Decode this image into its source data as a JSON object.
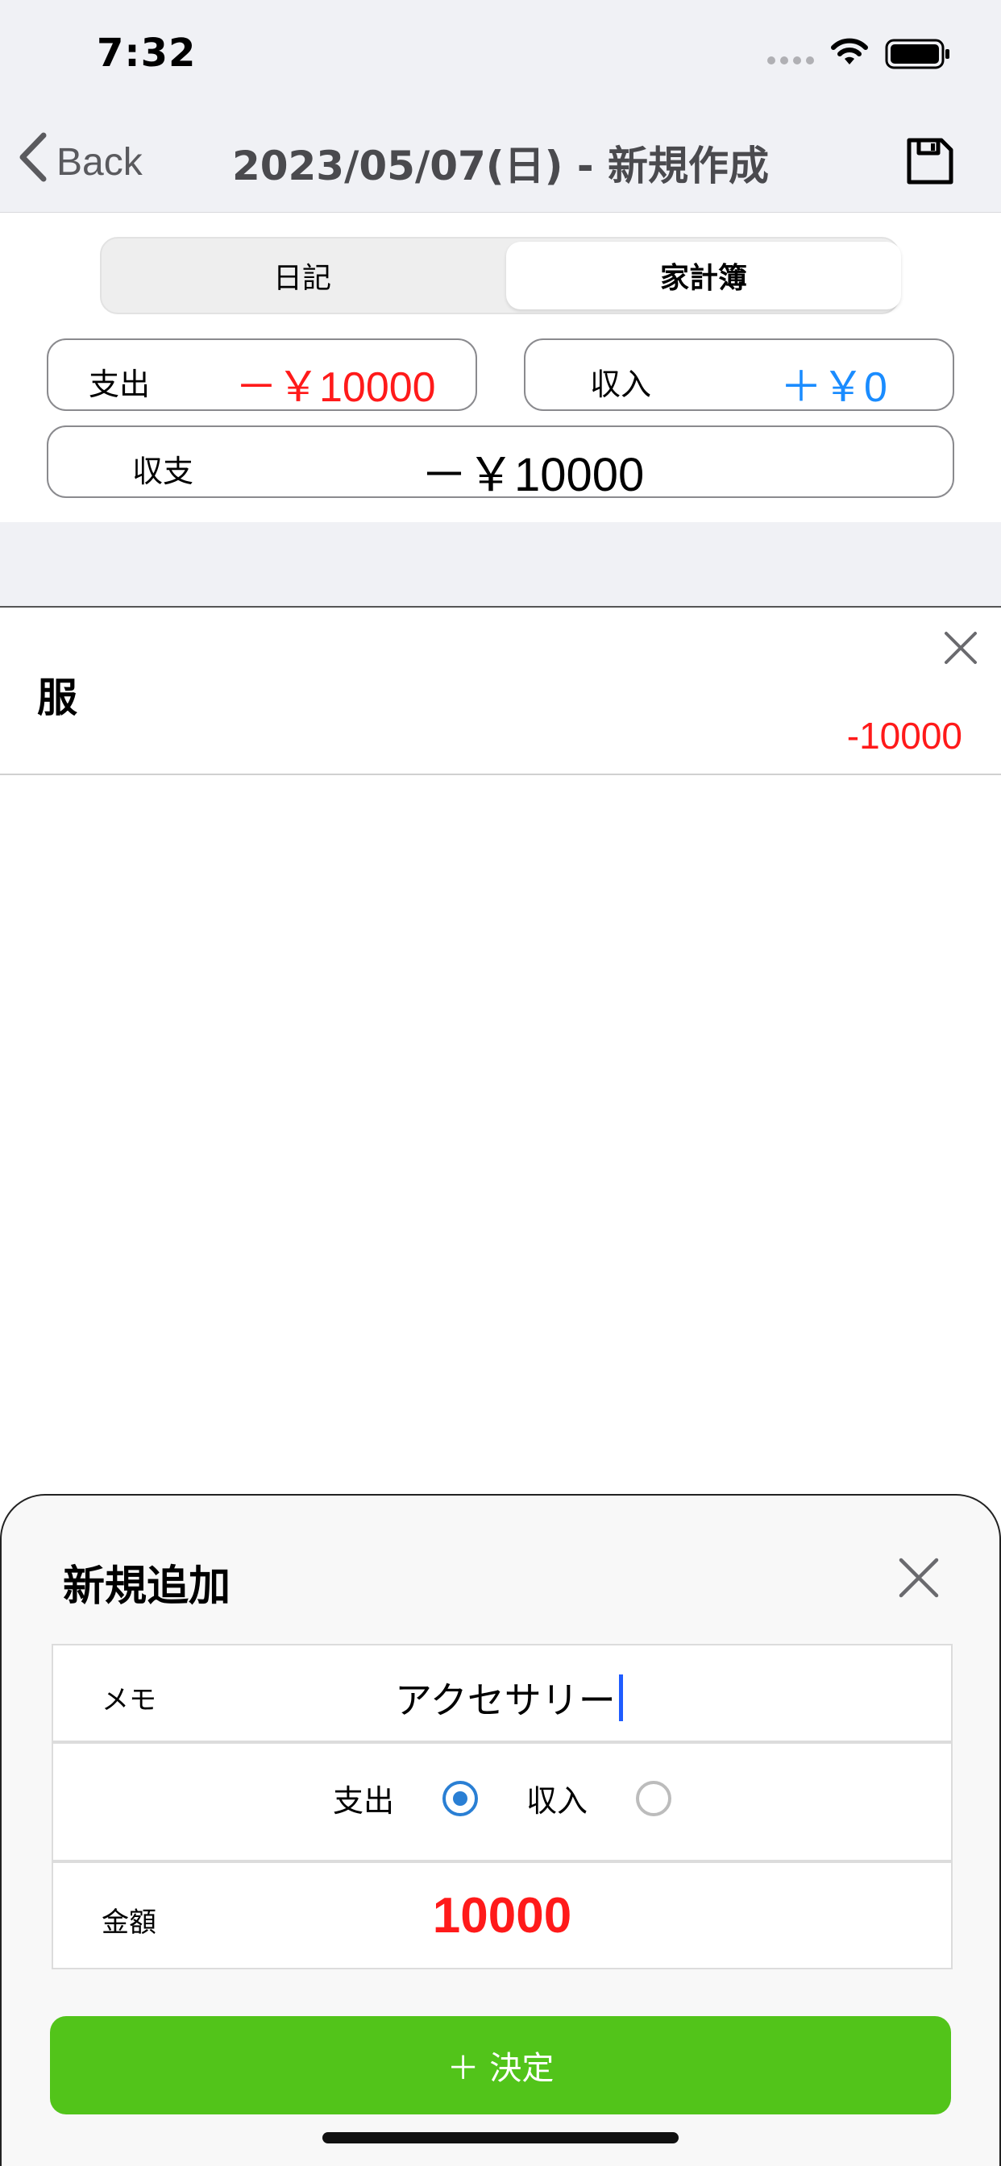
{
  "status_bar": {
    "time": "7:32"
  },
  "nav": {
    "back_label": "Back",
    "title": "2023/05/07(日) - 新規作成",
    "icons": {
      "back": "chevron-left-icon",
      "save": "save-icon"
    }
  },
  "segment": {
    "tabs": [
      "日記",
      "家計簿"
    ],
    "selected": "家計簿"
  },
  "summary": {
    "expense_label": "支出",
    "expense_value": "－￥10000",
    "income_label": "収入",
    "income_value": "＋￥0",
    "balance_label": "収支",
    "balance_value": "－￥10000"
  },
  "entries": [
    {
      "category": "服",
      "amount": "-10000"
    }
  ],
  "sheet": {
    "title": "新規追加",
    "memo_label": "メモ",
    "memo_value": "アクセサリー",
    "type_expense_label": "支出",
    "type_income_label": "収入",
    "type_selected": "支出",
    "amount_label": "金額",
    "amount_value": "10000",
    "confirm_label": "＋ 決定"
  },
  "colors": {
    "expense": "#ff1a1a",
    "income": "#1a8cff",
    "confirm": "#52c41a",
    "radio_selected": "#2a7fd4"
  }
}
